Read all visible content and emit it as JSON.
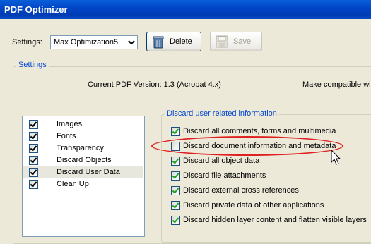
{
  "window": {
    "title": "PDF Optimizer"
  },
  "settings": {
    "label": "Settings:",
    "selected_value": "Max Optimization5",
    "delete_label": "Delete",
    "save_label": "Save"
  },
  "group": {
    "title": "Settings",
    "version_text": "Current PDF Version: 1.3 (Acrobat 4.x)",
    "make_compatible_text": "Make compatible wit"
  },
  "panels": [
    {
      "label": "Images",
      "checked": true
    },
    {
      "label": "Fonts",
      "checked": true
    },
    {
      "label": "Transparency",
      "checked": true
    },
    {
      "label": "Discard Objects",
      "checked": true
    },
    {
      "label": "Discard User Data",
      "checked": true,
      "selected": true
    },
    {
      "label": "Clean Up",
      "checked": true
    }
  ],
  "discard_group": {
    "title": "Discard user related information",
    "options": [
      {
        "label": "Discard all comments, forms and multimedia",
        "checked": true
      },
      {
        "label": "Discard document information and metadata",
        "checked": false
      },
      {
        "label": "Discard all object data",
        "checked": true
      },
      {
        "label": "Discard file attachments",
        "checked": true
      },
      {
        "label": "Discard external cross references",
        "checked": true
      },
      {
        "label": "Discard private data of other applications",
        "checked": true
      },
      {
        "label": "Discard hidden layer content and flatten visible layers",
        "checked": true
      }
    ]
  },
  "colors": {
    "title_bar": "#0046c8",
    "highlight_oval": "#e02020",
    "check": "#21a121"
  }
}
